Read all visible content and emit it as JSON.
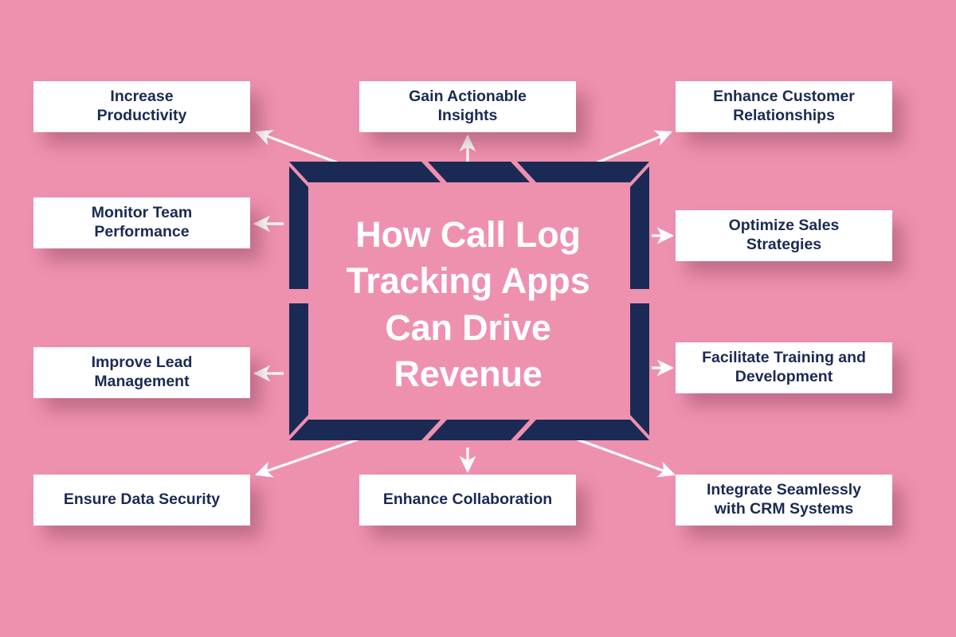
{
  "theme": {
    "background": "#ee91af",
    "frame_navy": "#1b2a54",
    "box_fill": "#ffffff",
    "label_navy": "#1b2a54",
    "title_text": "#ffffff",
    "arrow_color": "#ffffff"
  },
  "center": {
    "title": "How Call Log Tracking Apps Can Drive Revenue"
  },
  "nodes": [
    {
      "id": "increase-productivity",
      "label": "Increase\nProductivity"
    },
    {
      "id": "gain-actionable-insights",
      "label": "Gain Actionable\nInsights"
    },
    {
      "id": "enhance-customer",
      "label": "Enhance Customer\nRelationships"
    },
    {
      "id": "monitor-team",
      "label": "Monitor Team\nPerformance"
    },
    {
      "id": "improve-lead",
      "label": "Improve Lead\nManagement"
    },
    {
      "id": "ensure-data-security",
      "label": "Ensure Data Security"
    },
    {
      "id": "optimize-sales",
      "label": "Optimize Sales\nStrategies"
    },
    {
      "id": "facilitate-training",
      "label": "Facilitate Training and\nDevelopment"
    },
    {
      "id": "integrate-crm",
      "label": "Integrate Seamlessly\nwith CRM Systems"
    },
    {
      "id": "enhance-collaboration",
      "label": "Enhance Collaboration"
    }
  ],
  "connectors": [
    {
      "id": "to-increase-productivity",
      "from": "center-frame",
      "to": "increase-productivity",
      "direction": "up-left"
    },
    {
      "id": "to-gain-actionable-insights",
      "from": "center-frame",
      "to": "gain-actionable-insights",
      "direction": "up"
    },
    {
      "id": "to-enhance-customer",
      "from": "center-frame",
      "to": "enhance-customer",
      "direction": "up-right"
    },
    {
      "id": "to-monitor-team",
      "from": "center-frame",
      "to": "monitor-team",
      "direction": "left"
    },
    {
      "id": "to-improve-lead",
      "from": "center-frame",
      "to": "improve-lead",
      "direction": "left"
    },
    {
      "id": "to-ensure-data-security",
      "from": "center-frame",
      "to": "ensure-data-security",
      "direction": "down-left"
    },
    {
      "id": "to-optimize-sales",
      "from": "center-frame",
      "to": "optimize-sales",
      "direction": "right"
    },
    {
      "id": "to-facilitate-training",
      "from": "center-frame",
      "to": "facilitate-training",
      "direction": "right"
    },
    {
      "id": "to-integrate-crm",
      "from": "center-frame",
      "to": "integrate-crm",
      "direction": "down-right"
    },
    {
      "id": "to-enhance-collaboration",
      "from": "center-frame",
      "to": "enhance-collaboration",
      "direction": "down"
    }
  ]
}
